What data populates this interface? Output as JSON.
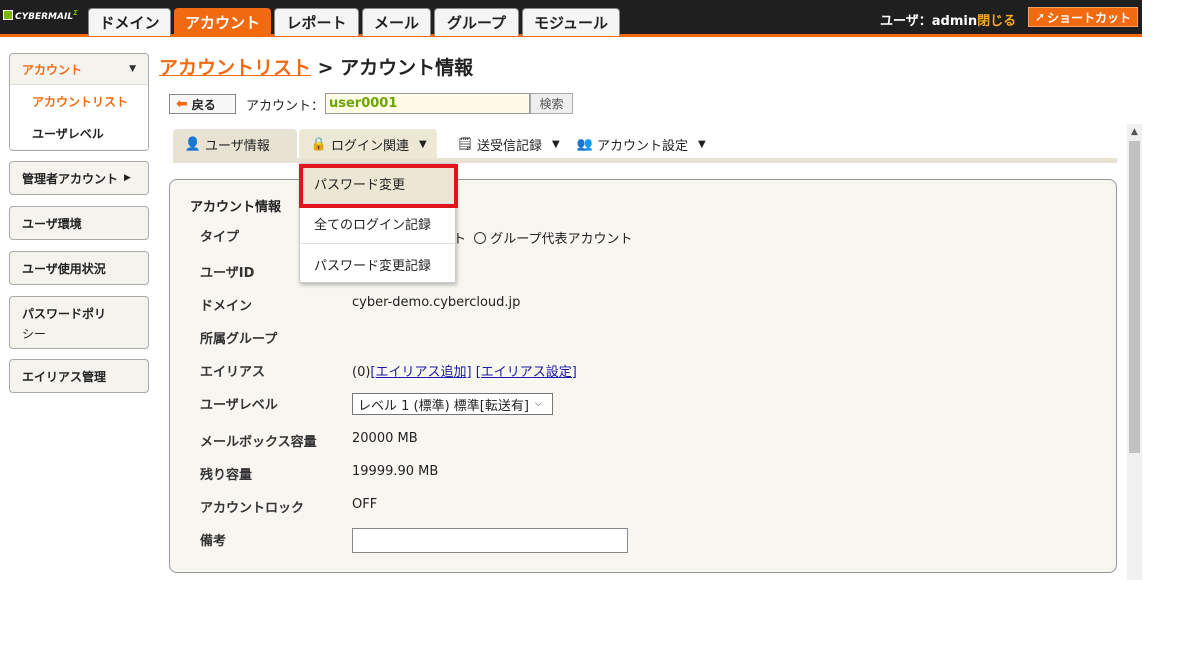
{
  "app": {
    "logo": "CYBERMAIL",
    "logo_sup": "Σ"
  },
  "nav": {
    "tabs": [
      {
        "label": "ドメイン"
      },
      {
        "label": "アカウント"
      },
      {
        "label": "レポート"
      },
      {
        "label": "メール"
      },
      {
        "label": "グループ"
      },
      {
        "label": "モジュール"
      }
    ],
    "active_tab": "アカウント"
  },
  "user": {
    "label": "ユーザ：admin",
    "close": "閉じる"
  },
  "shortcut": "ショートカット",
  "sidebar": {
    "account": {
      "header": "アカウント",
      "items": [
        "アカウントリスト",
        "ユーザレベル"
      ]
    },
    "admin_account": "管理者アカウント",
    "user_env": "ユーザ環境",
    "user_usage": "ユーザ使用状況",
    "password_policy_1": "パスワードポリ",
    "password_policy_2": "シー",
    "alias_mgmt": "エイリアス管理"
  },
  "breadcrumb": {
    "link": "アカウントリスト",
    "sep": " > ",
    "current": "アカウント情報"
  },
  "toolbar": {
    "back": "戻る",
    "account_label": "アカウント：",
    "account_value": "user0001",
    "search": "検索"
  },
  "subtabs": {
    "user_info": "ユーザ情報",
    "login": "ログイン関連",
    "mail_log": "送受信記録",
    "account_settings": "アカウント設定"
  },
  "dropdown": {
    "items": [
      "パスワード変更",
      "全てのログイン記録",
      "パスワード変更記録"
    ]
  },
  "info": {
    "section_title": "アカウント情報",
    "rows": {
      "type": {
        "label": "タイプ",
        "value_partial": "ト",
        "radio2": "グループ代表アカウント"
      },
      "user_id": {
        "label": "ユーザID"
      },
      "domain": {
        "label": "ドメイン",
        "value": "cyber-demo.cybercloud.jp"
      },
      "group": {
        "label": "所属グループ"
      },
      "alias": {
        "label": "エイリアス",
        "count": "(0)",
        "add": "[エイリアス追加]",
        "settings": "[エイリアス設定]"
      },
      "level": {
        "label": "ユーザレベル",
        "value": "レベル 1 (標準) 標準[転送有]"
      },
      "mailbox": {
        "label": "メールボックス容量",
        "value": "20000 MB"
      },
      "remaining": {
        "label": "残り容量",
        "value": "19999.90 MB"
      },
      "lock": {
        "label": "アカウントロック",
        "value": "OFF"
      },
      "remarks": {
        "label": "備考"
      }
    }
  }
}
